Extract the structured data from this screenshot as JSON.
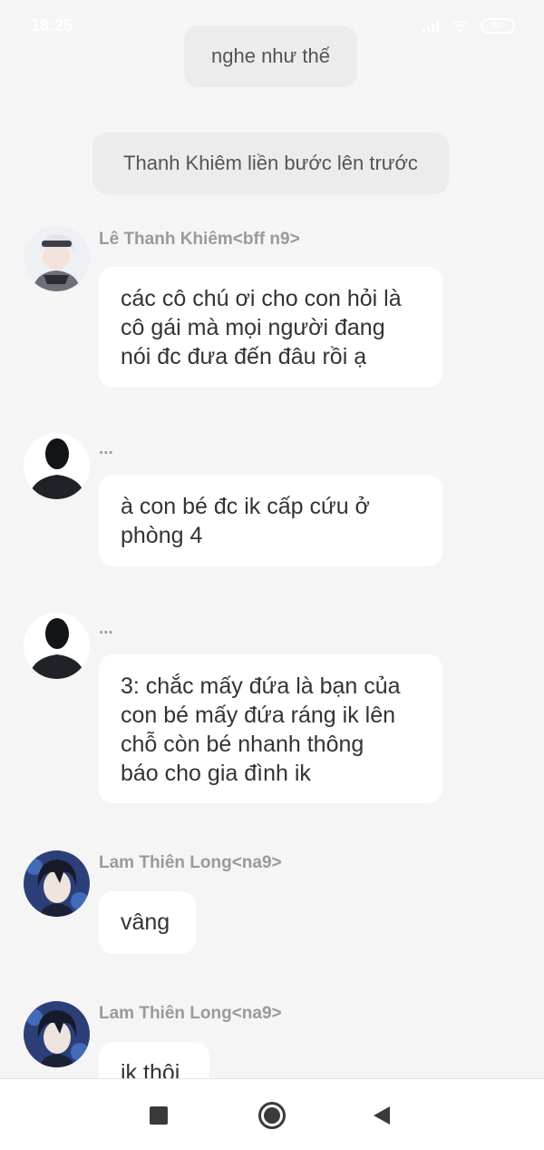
{
  "status_bar": {
    "time": "18:25",
    "battery": "66",
    "icons": [
      "signal-icon",
      "wifi-icon",
      "battery-icon"
    ]
  },
  "narration": [
    {
      "text": "nghe như thế"
    },
    {
      "text": "Thanh Khiêm liền bước lên trước"
    }
  ],
  "messages": [
    {
      "sender": "Lê Thanh Khiêm<bff n9>",
      "avatar": "anime-boy-white-hair-avatar",
      "lines": [
        "các cô chú ơi cho con hỏi là",
        "cô gái mà mọi người đang",
        "nói đc đưa đến đâu rồi ạ"
      ]
    },
    {
      "sender": "...",
      "avatar": "silhouette-avatar",
      "lines": [
        "à con bé đc ik cấp cứu ở",
        "phòng 4"
      ]
    },
    {
      "sender": "...",
      "avatar": "silhouette-avatar",
      "lines": [
        "3: chắc mấy đứa là bạn của",
        "con bé mấy đứa ráng ik lên",
        "chỗ còn bé nhanh thông",
        "báo cho gia đình ik"
      ]
    },
    {
      "sender": "Lam Thiên Long<na9>",
      "avatar": "anime-boy-dark-hair-avatar",
      "lines": [
        "vâng"
      ]
    },
    {
      "sender": "Lam Thiên Long<na9>",
      "avatar": "anime-boy-dark-hair-avatar",
      "lines": [
        "ik thôi"
      ]
    }
  ],
  "nav_bar": {
    "icons": [
      "recents-square-icon",
      "home-circle-icon",
      "back-triangle-icon"
    ]
  },
  "colors": {
    "background": "#f5f5f5",
    "bubble": "#ffffff",
    "narration_bubble": "#ececec",
    "sender_name": "#9a9a9a",
    "message_text": "#333333"
  }
}
